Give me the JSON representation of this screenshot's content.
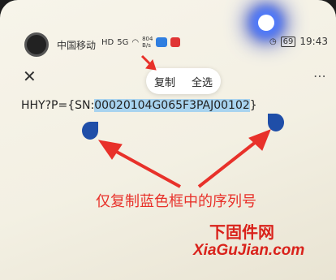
{
  "status_bar": {
    "carrier": "中国移动",
    "hd_badge": "HD",
    "signal_label": "5G",
    "net_speed_value": "804",
    "net_speed_unit": "B/s",
    "battery_level": "69",
    "time": "19:43"
  },
  "toolbar": {
    "close_symbol": "✕",
    "copy_label": "复制",
    "select_all_label": "全选",
    "more_symbol": "⋯"
  },
  "content": {
    "prefix_text": "HHY?P={SN:",
    "selected_text": "00020104G065F3PAJ00102",
    "suffix_text": "}"
  },
  "annotation": {
    "text": "仅复制蓝色框中的序列号",
    "color": "#e8312a"
  },
  "watermark": {
    "line1": "下固件网",
    "line2": "XiaGuJian.com"
  },
  "colors": {
    "selection": "#a8d3ef",
    "handle": "#1f4ea8"
  }
}
